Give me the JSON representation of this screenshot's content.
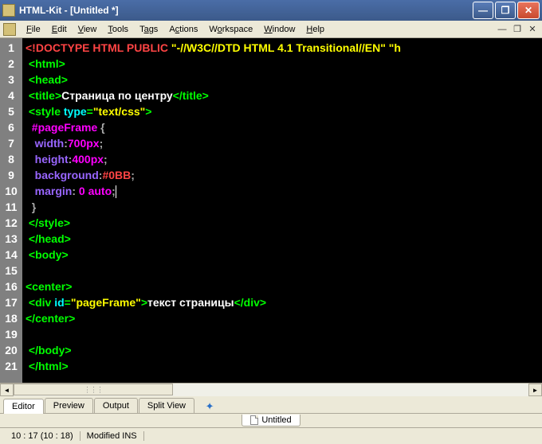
{
  "window": {
    "title": "HTML-Kit - [Untitled *]"
  },
  "menu": {
    "file": "File",
    "edit": "Edit",
    "view": "View",
    "tools": "Tools",
    "tags": "Tags",
    "actions": "Actions",
    "workspace": "Workspace",
    "window": "Window",
    "help": "Help"
  },
  "gutter_lines": [
    "1",
    "2",
    "3",
    "4",
    "5",
    "6",
    "7",
    "8",
    "9",
    "10",
    "11",
    "12",
    "13",
    "14",
    "15",
    "16",
    "17",
    "18",
    "19",
    "20",
    "21"
  ],
  "code": {
    "l1": {
      "p1": "<!DOCTYPE HTML PUBLIC ",
      "p2": "\"-//W3C//DTD HTML 4.1 Transitional//EN\" \"h"
    },
    "l2": {
      "p1": " <html>"
    },
    "l3": {
      "p1": " <head>"
    },
    "l4": {
      "p1": " <title>",
      "p2": "Страница по центру",
      "p3": "</title>"
    },
    "l5": {
      "p1": " <style ",
      "p2": "type",
      "p3": "=",
      "p4": "\"text/css\"",
      "p5": ">"
    },
    "l6": {
      "p1": "  #pageFrame ",
      "p2": "{"
    },
    "l7": {
      "p1": "   width",
      "p2": ":",
      "p3": "700px",
      "p4": ";"
    },
    "l8": {
      "p1": "   height",
      "p2": ":",
      "p3": "400px",
      "p4": ";"
    },
    "l9": {
      "p1": "   background",
      "p2": ":",
      "p3": "#0BB",
      "p4": ";"
    },
    "l10": {
      "p1": "   margin",
      "p2": ": ",
      "p3": "0 auto",
      "p4": ";"
    },
    "l11": {
      "p1": "  }"
    },
    "l12": {
      "p1": " </style>"
    },
    "l13": {
      "p1": " </head>"
    },
    "l14": {
      "p1": " <body>"
    },
    "l16": {
      "p1": "<center>"
    },
    "l17": {
      "p1": " <div ",
      "p2": "id",
      "p3": "=",
      "p4": "\"pageFrame\"",
      "p5": ">",
      "p6": "текст страницы",
      "p7": "</div>"
    },
    "l18": {
      "p1": "</center>"
    },
    "l20": {
      "p1": " </body>"
    },
    "l21": {
      "p1": " </html>"
    }
  },
  "tabs": {
    "editor": "Editor",
    "preview": "Preview",
    "output": "Output",
    "split": "Split View"
  },
  "doc_tab": "Untitled",
  "status": {
    "pos": "10 : 17 (10 : 18)",
    "mode": "Modified INS"
  }
}
